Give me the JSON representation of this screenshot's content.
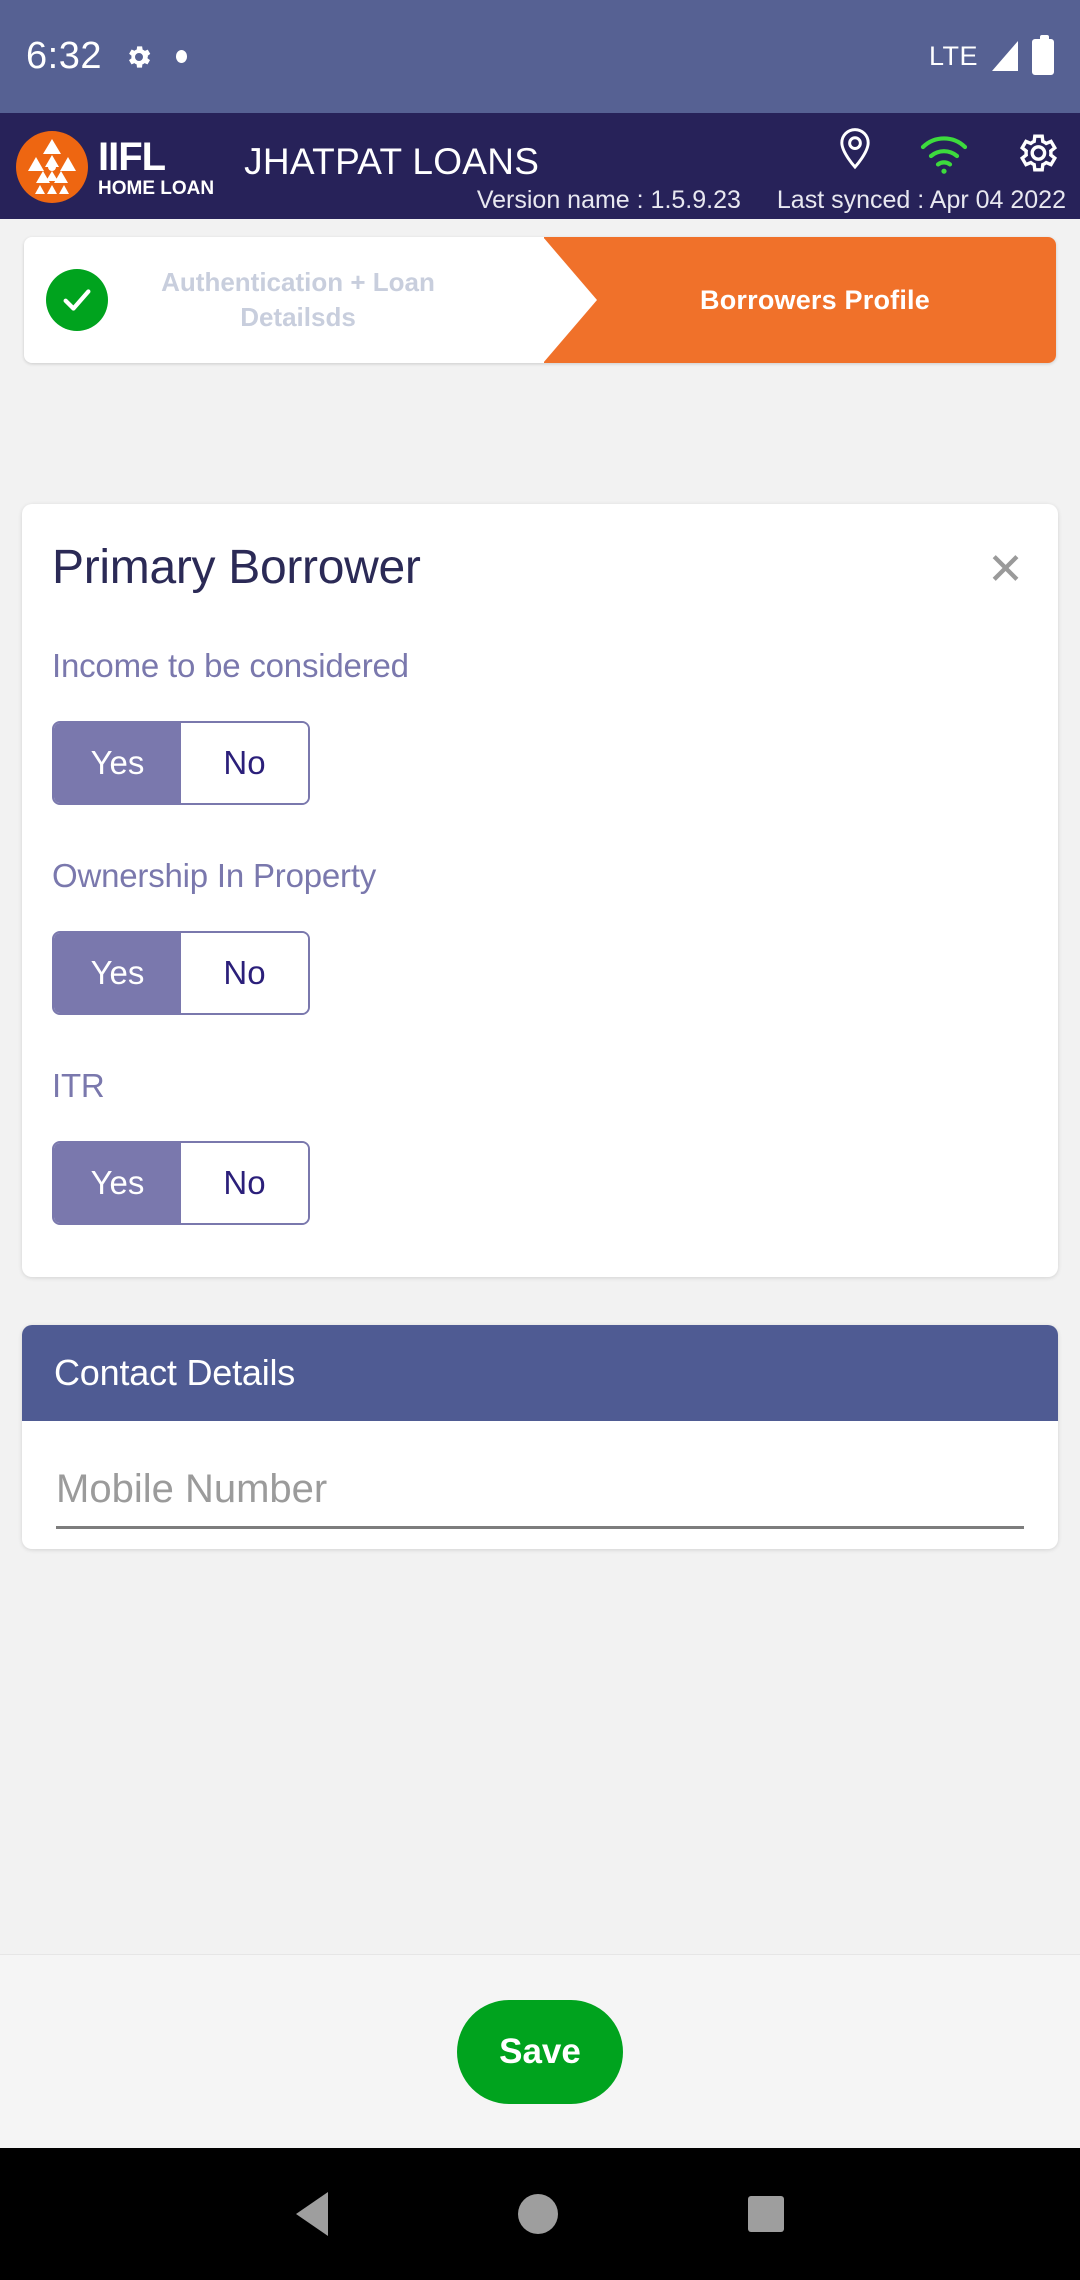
{
  "status_bar": {
    "time": "6:32",
    "gear_icon": "gear-icon",
    "dot_icon": "dot-icon",
    "network": "LTE",
    "signal_icon": "signal-triangle-icon",
    "battery_icon": "battery-full-icon"
  },
  "header": {
    "brand_name": "IIFL",
    "brand_sub": "HOME LOAN",
    "app_title": "JHATPAT LOANS",
    "version_label": "Version name : 1.5.9.23",
    "last_synced": "Last synced : Apr 04 2022",
    "icons": [
      {
        "name": "location-pin-icon",
        "color": "#ffffff"
      },
      {
        "name": "wifi-icon",
        "color": "#3ddb3d"
      },
      {
        "name": "gear-icon",
        "color": "#ffffff"
      }
    ],
    "colors": {
      "header_bg": "#272259",
      "status_bg": "#566193",
      "logo_orange": "#ee6611"
    }
  },
  "stepper": {
    "completed_step": "Authentication + Loan Detailsds",
    "active_step": "Borrowers Profile",
    "check_icon": "check-circle-icon",
    "colors": {
      "active_bg": "#f0712a",
      "check_bg": "#00a31e",
      "done_text": "#c8cedd"
    }
  },
  "primary_borrower_card": {
    "title": "Primary Borrower",
    "close_icon": "close-icon",
    "close_label": "✕",
    "fields": [
      {
        "label": "Income to be considered",
        "options": [
          "Yes",
          "No"
        ],
        "selected": "Yes"
      },
      {
        "label": "Ownership In Property",
        "options": [
          "Yes",
          "No"
        ],
        "selected": "Yes"
      },
      {
        "label": "ITR",
        "options": [
          "Yes",
          "No"
        ],
        "selected": "Yes"
      }
    ]
  },
  "contact_details_card": {
    "title": "Contact Details",
    "mobile_number": {
      "placeholder": "Mobile Number",
      "value": ""
    }
  },
  "bottom_bar": {
    "save_label": "Save",
    "save_color": "#00a31e"
  },
  "nav_bar": {
    "back_icon": "back-triangle-icon",
    "home_icon": "home-circle-icon",
    "recents_icon": "recents-square-icon"
  }
}
